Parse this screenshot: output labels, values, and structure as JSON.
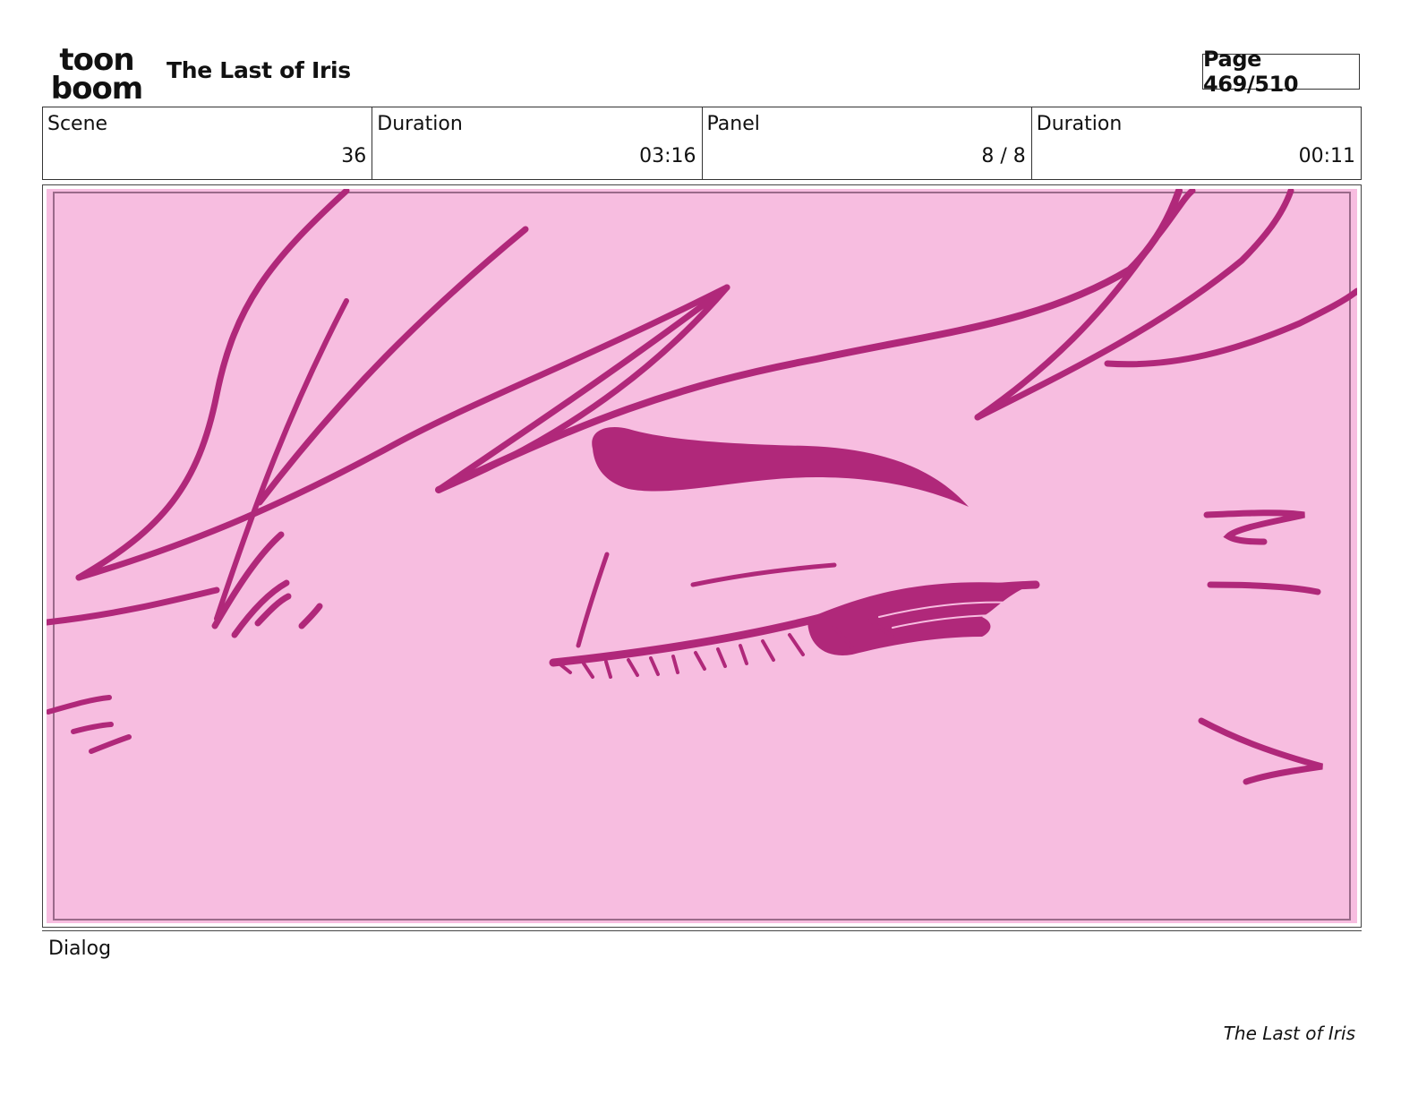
{
  "header": {
    "logo_top": "toon",
    "logo_bottom": "boom",
    "title": "The Last of Iris",
    "page_indicator": "Page 469/510"
  },
  "info": [
    {
      "label": "Scene",
      "value": "36"
    },
    {
      "label": "Duration",
      "value": "03:16"
    },
    {
      "label": "Panel",
      "value": "8 / 8"
    },
    {
      "label": "Duration",
      "value": "00:11"
    }
  ],
  "panel": {
    "background_color": "#f7bde0",
    "line_color": "#b0287a"
  },
  "dialog": {
    "label": "Dialog"
  },
  "footer": {
    "title": "The Last of Iris"
  }
}
